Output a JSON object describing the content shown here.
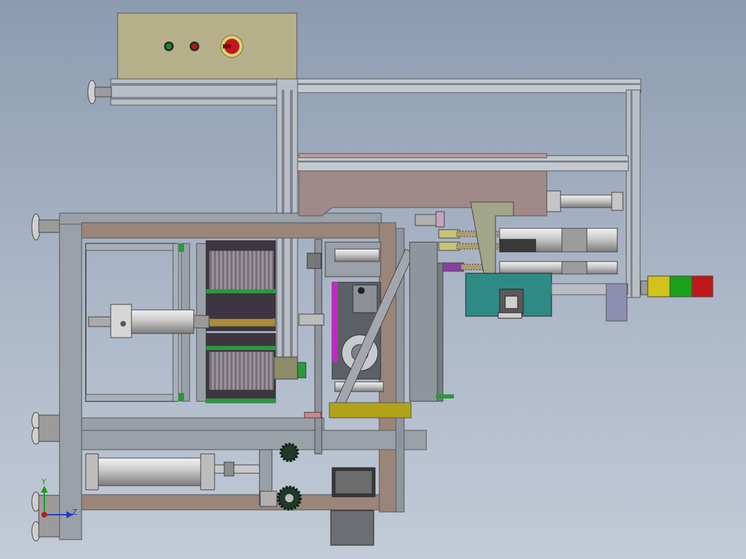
{
  "triad": {
    "y_label": "Y",
    "z_label": "Z"
  },
  "colors": {
    "background_top": "#8c9bb0",
    "background_bottom": "#c2cad7",
    "control_box": "#b6b08a",
    "frame_wood": "#9b8579",
    "frame_steel": "#9aa0a8",
    "hopper": "#a18989",
    "teal_block": "#2f8a86",
    "yellow_plate": "#b1a21a",
    "light_red": "#c0161a",
    "light_green": "#1aa01a",
    "light_yellow": "#d2c31a"
  },
  "icons": {
    "control_buttons": [
      "green-indicator-icon",
      "red-indicator-icon",
      "emergency-stop-icon"
    ],
    "tower_light": [
      "yellow-lamp-icon",
      "green-lamp-icon",
      "red-lamp-icon"
    ]
  }
}
